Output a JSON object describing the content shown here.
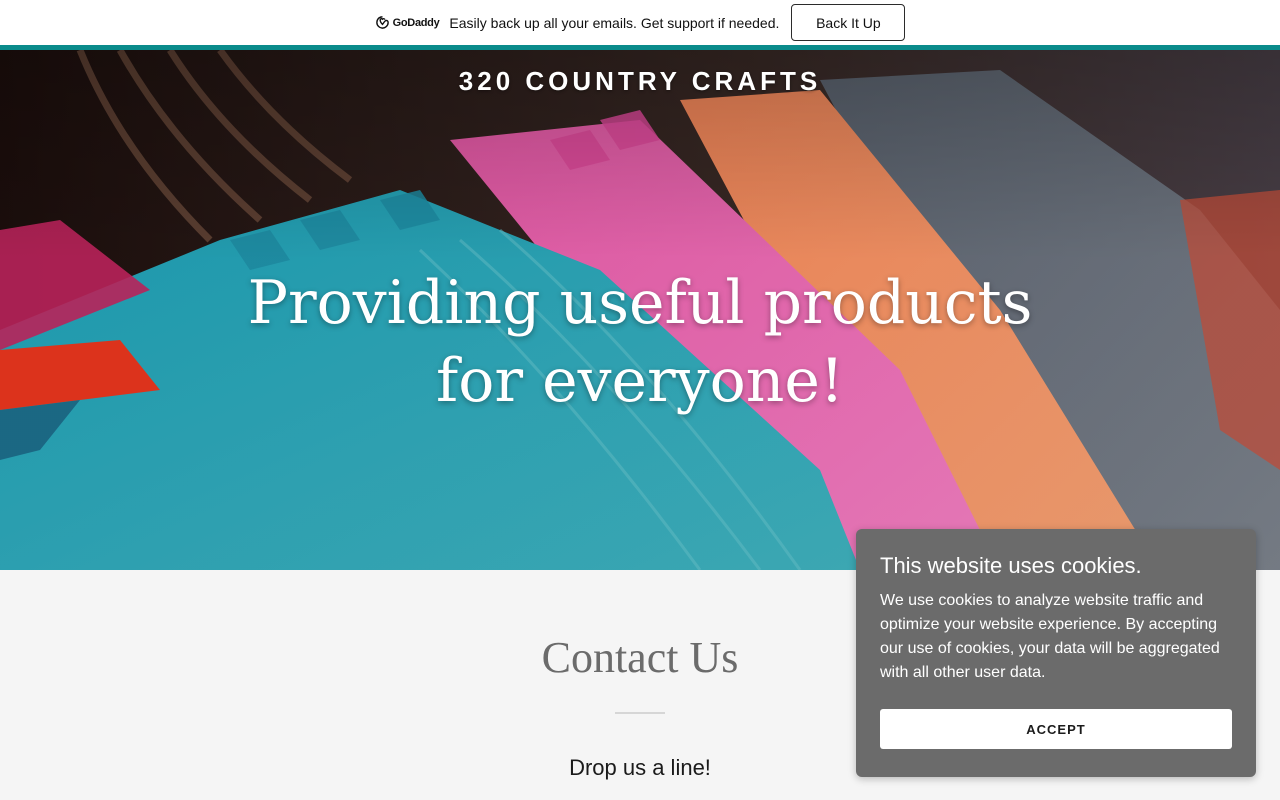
{
  "promo": {
    "brand": "GoDaddy",
    "message": "Easily back up all your emails. Get support if needed.",
    "button_label": "Back It Up",
    "accent_color": "#0a8b8b"
  },
  "hero": {
    "site_title": "320 COUNTRY CRAFTS",
    "tagline": "Providing useful products for everyone!"
  },
  "contact": {
    "title": "Contact Us",
    "subtitle": "Drop us a line!"
  },
  "cookie_banner": {
    "title": "This website uses cookies.",
    "body": "We use cookies to analyze website traffic and optimize your website experience. By accepting our use of cookies, your data will be aggregated with all other user data.",
    "accept_label": "ACCEPT"
  }
}
